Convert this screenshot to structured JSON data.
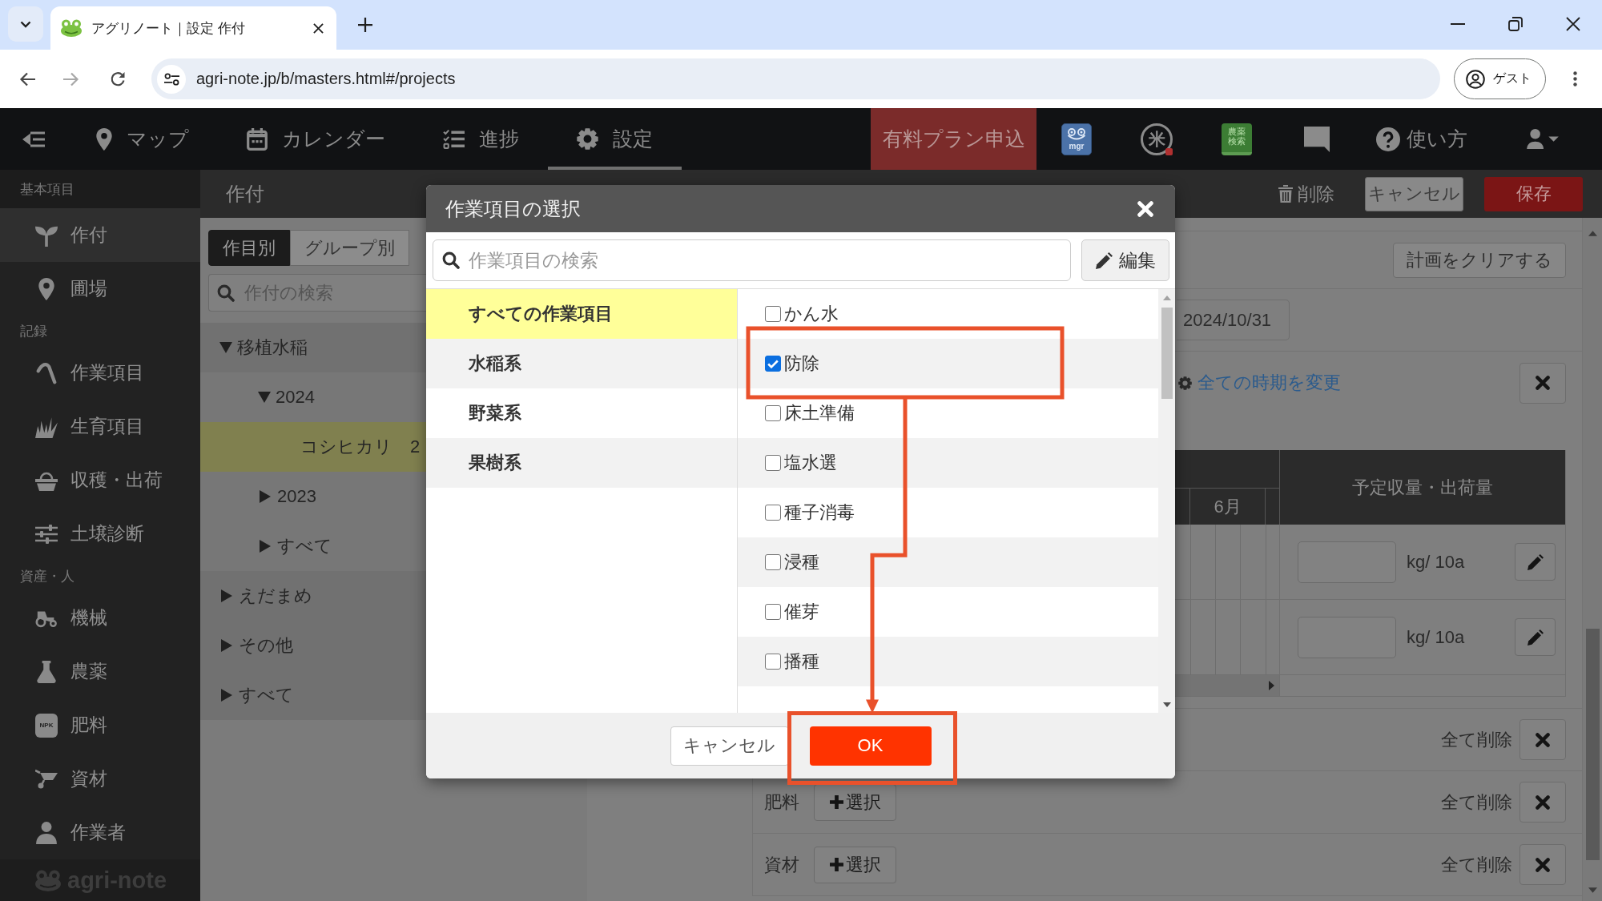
{
  "browser": {
    "tab_title": "アグリノート｜設定 作付",
    "address": "agri-note.jp/b/masters.html#/projects",
    "profile": "ゲスト"
  },
  "header": {
    "nav": [
      {
        "label": "マップ",
        "selected": false
      },
      {
        "label": "カレンダー",
        "selected": false
      },
      {
        "label": "進捗",
        "selected": false
      },
      {
        "label": "設定",
        "selected": true
      }
    ],
    "upgrade": "有料プラン申込",
    "apps": [
      {
        "label": "mgr"
      },
      {
        "label": "米"
      },
      {
        "label": "農薬検索"
      }
    ],
    "help": "使い方"
  },
  "sidebar": {
    "sections": [
      {
        "title": "基本項目",
        "items": [
          {
            "label": "作付",
            "selected": true
          },
          {
            "label": "圃場",
            "selected": false
          }
        ]
      },
      {
        "title": "記録",
        "items": [
          {
            "label": "作業項目",
            "selected": false
          },
          {
            "label": "生育項目",
            "selected": false
          },
          {
            "label": "収穫・出荷",
            "selected": false
          },
          {
            "label": "土壌診断",
            "selected": false
          }
        ]
      },
      {
        "title": "資産・人",
        "items": [
          {
            "label": "機械",
            "selected": false
          },
          {
            "label": "農薬",
            "selected": false
          },
          {
            "label": "肥料",
            "selected": false,
            "icon_text": "NPK"
          },
          {
            "label": "資材",
            "selected": false
          },
          {
            "label": "作業者",
            "selected": false
          }
        ]
      }
    ],
    "logo": "agri-note"
  },
  "page": {
    "title": "作付",
    "delete": "削除",
    "cancel": "キャンセル",
    "save": "保存"
  },
  "crop_list": {
    "tabs": [
      {
        "label": "作目別",
        "selected": true
      },
      {
        "label": "グループ別",
        "selected": false
      }
    ],
    "search": {
      "placeholder": "作付の検索"
    },
    "tree": [
      {
        "label": "移植水稲",
        "expanded": true,
        "selected": false,
        "children": [
          {
            "label": "2024",
            "expanded": true,
            "selected": false,
            "children": [
              {
                "label": "コシヒカリ　2",
                "selected": true
              }
            ]
          },
          {
            "label": "2023",
            "expanded": false,
            "selected": false
          },
          {
            "label": "すべて",
            "expanded": false,
            "selected": false
          }
        ]
      },
      {
        "label": "えだまめ",
        "expanded": false,
        "selected": false
      },
      {
        "label": "その他",
        "expanded": false,
        "selected": false
      },
      {
        "label": "すべて",
        "expanded": false,
        "selected": false
      }
    ]
  },
  "plan": {
    "clear_button": "計画をクリアする",
    "date": "2024/10/31",
    "change_all_link": "全ての時期を変更",
    "schedule": {
      "month": "6月",
      "yield_header": "予定収量・出荷量",
      "rows": [
        {
          "unit": "kg/ 10a"
        },
        {
          "unit": "kg/ 10a"
        }
      ]
    },
    "resources": [
      {
        "delete_all": "全て削除"
      },
      {
        "label": "肥料",
        "select_button": "選択",
        "delete_all": "全て削除"
      },
      {
        "label": "資材",
        "select_button": "選択",
        "delete_all": "全て削除"
      }
    ]
  },
  "dialog": {
    "title": "作業項目の選択",
    "search": {
      "placeholder": "作業項目の検索"
    },
    "edit_button": "編集",
    "categories": [
      {
        "label": "すべての作業項目",
        "selected": true
      },
      {
        "label": "水稲系",
        "selected": false
      },
      {
        "label": "野菜系",
        "selected": false
      },
      {
        "label": "果樹系",
        "selected": false
      }
    ],
    "items": [
      {
        "label": "かん水",
        "checked": false,
        "highlighted": false
      },
      {
        "label": "防除",
        "checked": true,
        "highlighted": true
      },
      {
        "label": "床土準備",
        "checked": false,
        "highlighted": false
      },
      {
        "label": "塩水選",
        "checked": false,
        "highlighted": false
      },
      {
        "label": "種子消毒",
        "checked": false,
        "highlighted": false
      },
      {
        "label": "浸種",
        "checked": false,
        "highlighted": false
      },
      {
        "label": "催芽",
        "checked": false,
        "highlighted": false
      },
      {
        "label": "播種",
        "checked": false,
        "highlighted": false
      }
    ],
    "cancel_button": "キャンセル",
    "ok_button": {
      "label": "OK",
      "highlighted": true
    }
  }
}
